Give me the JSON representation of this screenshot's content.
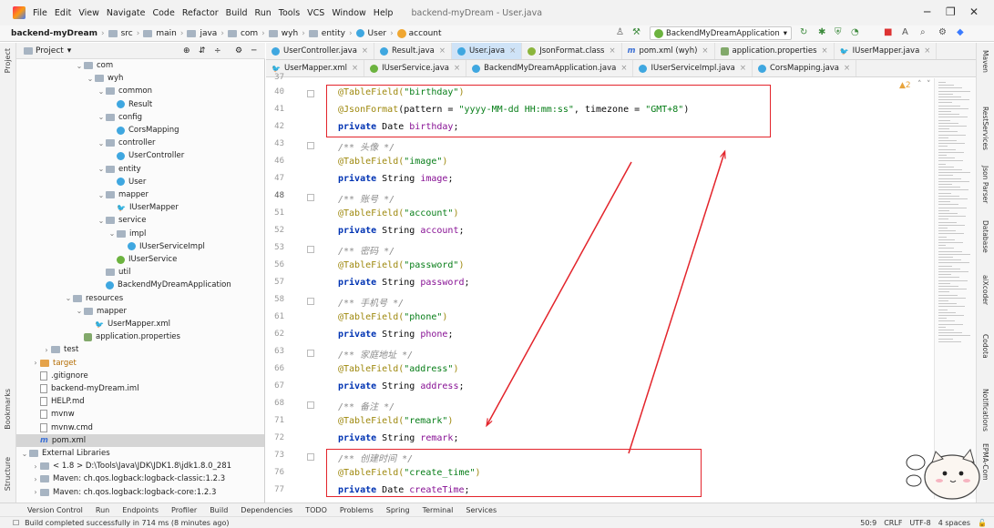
{
  "window": {
    "title": "backend-myDream - User.java",
    "menu": [
      "File",
      "Edit",
      "View",
      "Navigate",
      "Code",
      "Refactor",
      "Build",
      "Run",
      "Tools",
      "VCS",
      "Window",
      "Help"
    ]
  },
  "breadcrumb": [
    "backend-myDream",
    "src",
    "main",
    "java",
    "com",
    "wyh",
    "entity",
    "User",
    "account"
  ],
  "run_config": "BackendMyDreamApplication",
  "project": {
    "header": "Project",
    "tree": [
      {
        "label": "com",
        "type": "folder",
        "indent": 5,
        "arrow": "down"
      },
      {
        "label": "wyh",
        "type": "folder",
        "indent": 6,
        "arrow": "down"
      },
      {
        "label": "common",
        "type": "folder",
        "indent": 7,
        "arrow": "down"
      },
      {
        "label": "Result",
        "type": "class",
        "indent": 8,
        "arrow": ""
      },
      {
        "label": "config",
        "type": "folder",
        "indent": 7,
        "arrow": "down"
      },
      {
        "label": "CorsMapping",
        "type": "class",
        "indent": 8,
        "arrow": ""
      },
      {
        "label": "controller",
        "type": "folder",
        "indent": 7,
        "arrow": "down"
      },
      {
        "label": "UserController",
        "type": "class",
        "indent": 8,
        "arrow": ""
      },
      {
        "label": "entity",
        "type": "folder",
        "indent": 7,
        "arrow": "down"
      },
      {
        "label": "User",
        "type": "class",
        "indent": 8,
        "arrow": ""
      },
      {
        "label": "mapper",
        "type": "folder",
        "indent": 7,
        "arrow": "down"
      },
      {
        "label": "IUserMapper",
        "type": "mapper",
        "indent": 8,
        "arrow": ""
      },
      {
        "label": "service",
        "type": "folder",
        "indent": 7,
        "arrow": "down"
      },
      {
        "label": "impl",
        "type": "folder",
        "indent": 8,
        "arrow": "down"
      },
      {
        "label": "IUserServiceImpl",
        "type": "class",
        "indent": 9,
        "arrow": ""
      },
      {
        "label": "IUserService",
        "type": "interface",
        "indent": 8,
        "arrow": ""
      },
      {
        "label": "util",
        "type": "folder",
        "indent": 7,
        "arrow": ""
      },
      {
        "label": "BackendMyDreamApplication",
        "type": "class",
        "indent": 7,
        "arrow": ""
      },
      {
        "label": "resources",
        "type": "folder",
        "indent": 4,
        "arrow": "down"
      },
      {
        "label": "mapper",
        "type": "folder",
        "indent": 5,
        "arrow": "down"
      },
      {
        "label": "UserMapper.xml",
        "type": "mapper",
        "indent": 6,
        "arrow": ""
      },
      {
        "label": "application.properties",
        "type": "props",
        "indent": 5,
        "arrow": ""
      },
      {
        "label": "test",
        "type": "folder",
        "indent": 2,
        "arrow": "right"
      },
      {
        "label": "target",
        "type": "folder-orange",
        "indent": 1,
        "arrow": "right"
      },
      {
        "label": ".gitignore",
        "type": "file",
        "indent": 1,
        "arrow": ""
      },
      {
        "label": "backend-myDream.iml",
        "type": "file",
        "indent": 1,
        "arrow": ""
      },
      {
        "label": "HELP.md",
        "type": "file",
        "indent": 1,
        "arrow": ""
      },
      {
        "label": "mvnw",
        "type": "file",
        "indent": 1,
        "arrow": ""
      },
      {
        "label": "mvnw.cmd",
        "type": "file",
        "indent": 1,
        "arrow": ""
      },
      {
        "label": "pom.xml",
        "type": "pom",
        "indent": 1,
        "arrow": "",
        "selected": true
      },
      {
        "label": "External Libraries",
        "type": "lib",
        "indent": 0,
        "arrow": "down"
      },
      {
        "label": "< 1.8 >  D:\\Tools\\Java\\JDK\\JDK1.8\\jdk1.8.0_281",
        "type": "lib",
        "indent": 1,
        "arrow": "right"
      },
      {
        "label": "Maven: ch.qos.logback:logback-classic:1.2.3",
        "type": "lib",
        "indent": 1,
        "arrow": "right"
      },
      {
        "label": "Maven: ch.qos.logback:logback-core:1.2.3",
        "type": "lib",
        "indent": 1,
        "arrow": "right"
      }
    ]
  },
  "tabs_row1": [
    {
      "label": "UserController.java",
      "icon": "class"
    },
    {
      "label": "Result.java",
      "icon": "class"
    },
    {
      "label": "User.java",
      "icon": "class",
      "active": true
    },
    {
      "label": "JsonFormat.class",
      "icon": "annotation"
    },
    {
      "label": "pom.xml (wyh)",
      "icon": "pom"
    },
    {
      "label": "application.properties",
      "icon": "props"
    },
    {
      "label": "IUserMapper.java",
      "icon": "mapper"
    }
  ],
  "tabs_row2": [
    {
      "label": "UserMapper.xml",
      "icon": "mapper"
    },
    {
      "label": "IUserService.java",
      "icon": "interface"
    },
    {
      "label": "BackendMyDreamApplication.java",
      "icon": "class"
    },
    {
      "label": "IUserServiceImpl.java",
      "icon": "class"
    },
    {
      "label": "CorsMapping.java",
      "icon": "class"
    }
  ],
  "code_lines": [
    {
      "ln": "40",
      "tokens": [
        [
          "ann",
          "@TableField("
        ],
        [
          "str",
          "\"birthday\""
        ],
        [
          "ann",
          ")"
        ]
      ]
    },
    {
      "ln": "41",
      "tokens": [
        [
          "ann",
          "@JsonFormat"
        ],
        [
          "plain",
          "(pattern = "
        ],
        [
          "str",
          "\"yyyy-MM-dd HH:mm:ss\""
        ],
        [
          "plain",
          ", timezone = "
        ],
        [
          "str",
          "\"GMT+8\""
        ],
        [
          "plain",
          ")"
        ]
      ]
    },
    {
      "ln": "42",
      "tokens": [
        [
          "kw",
          "private "
        ],
        [
          "plain",
          "Date "
        ],
        [
          "fld",
          "birthday"
        ],
        [
          "plain",
          ";"
        ]
      ]
    },
    {
      "ln": "43",
      "tokens": [
        [
          "cmt",
          "/** 头像 */"
        ]
      ]
    },
    {
      "ln": "46",
      "tokens": [
        [
          "ann",
          "@TableField("
        ],
        [
          "str",
          "\"image\""
        ],
        [
          "ann",
          ")"
        ]
      ]
    },
    {
      "ln": "47",
      "tokens": [
        [
          "kw",
          "private "
        ],
        [
          "plain",
          "String "
        ],
        [
          "fld",
          "image"
        ],
        [
          "plain",
          ";"
        ]
      ]
    },
    {
      "ln": "48",
      "tokens": [
        [
          "cmt",
          "/** 账号 */"
        ]
      ]
    },
    {
      "ln": "51",
      "tokens": [
        [
          "ann",
          "@TableField("
        ],
        [
          "str",
          "\"account\""
        ],
        [
          "ann",
          ")"
        ]
      ]
    },
    {
      "ln": "52",
      "tokens": [
        [
          "kw",
          "private "
        ],
        [
          "plain",
          "String "
        ],
        [
          "fld",
          "account"
        ],
        [
          "plain",
          ";"
        ]
      ]
    },
    {
      "ln": "53",
      "tokens": [
        [
          "cmt",
          "/** 密码 */"
        ]
      ]
    },
    {
      "ln": "56",
      "tokens": [
        [
          "ann",
          "@TableField("
        ],
        [
          "str",
          "\"password\""
        ],
        [
          "ann",
          ")"
        ]
      ]
    },
    {
      "ln": "57",
      "tokens": [
        [
          "kw",
          "private "
        ],
        [
          "plain",
          "String "
        ],
        [
          "fld",
          "password"
        ],
        [
          "plain",
          ";"
        ]
      ]
    },
    {
      "ln": "58",
      "tokens": [
        [
          "cmt",
          "/** 手机号 */"
        ]
      ]
    },
    {
      "ln": "61",
      "tokens": [
        [
          "ann",
          "@TableField("
        ],
        [
          "str",
          "\"phone\""
        ],
        [
          "ann",
          ")"
        ]
      ]
    },
    {
      "ln": "62",
      "tokens": [
        [
          "kw",
          "private "
        ],
        [
          "plain",
          "String "
        ],
        [
          "fld",
          "phone"
        ],
        [
          "plain",
          ";"
        ]
      ]
    },
    {
      "ln": "63",
      "tokens": [
        [
          "cmt",
          "/** 家庭地址 */"
        ]
      ]
    },
    {
      "ln": "66",
      "tokens": [
        [
          "ann",
          "@TableField("
        ],
        [
          "str",
          "\"address\""
        ],
        [
          "ann",
          ")"
        ]
      ]
    },
    {
      "ln": "67",
      "tokens": [
        [
          "kw",
          "private "
        ],
        [
          "plain",
          "String "
        ],
        [
          "fld",
          "address"
        ],
        [
          "plain",
          ";"
        ]
      ]
    },
    {
      "ln": "68",
      "tokens": [
        [
          "cmt",
          "/** 备注 */"
        ]
      ]
    },
    {
      "ln": "71",
      "tokens": [
        [
          "ann",
          "@TableField("
        ],
        [
          "str",
          "\"remark\""
        ],
        [
          "ann",
          ")"
        ]
      ]
    },
    {
      "ln": "72",
      "tokens": [
        [
          "kw",
          "private "
        ],
        [
          "plain",
          "String "
        ],
        [
          "fld",
          "remark"
        ],
        [
          "plain",
          ";"
        ]
      ]
    },
    {
      "ln": "73",
      "tokens": [
        [
          "cmt",
          "/** 创建时间 */"
        ]
      ]
    },
    {
      "ln": "76",
      "tokens": [
        [
          "ann",
          "@TableField("
        ],
        [
          "str",
          "\"create_time\""
        ],
        [
          "ann",
          ")"
        ]
      ]
    },
    {
      "ln": "77",
      "tokens": [
        [
          "kw",
          "private "
        ],
        [
          "plain",
          "Date "
        ],
        [
          "fld",
          "createTime"
        ],
        [
          "plain",
          ";"
        ]
      ]
    }
  ],
  "inspection": "▲2",
  "right_tools": [
    "Maven",
    "RestServices",
    "Json Parser",
    "Database",
    "aiXcoder",
    "Codota",
    "Notifications",
    "EPMA-Com"
  ],
  "left_tools": [
    "Project",
    "Bookmarks",
    "Structure"
  ],
  "bottom_tabs": [
    "Version Control",
    "Run",
    "Endpoints",
    "Profiler",
    "Build",
    "Dependencies",
    "TODO",
    "Problems",
    "Spring",
    "Terminal",
    "Services"
  ],
  "status": {
    "message": "Build completed successfully in 714 ms (8 minutes ago)",
    "position": "50:9",
    "line_sep": "CRLF",
    "encoding": "UTF-8",
    "indent": "4 spaces"
  },
  "colors": {
    "highlight_red": "#e3242b",
    "keyword": "#0033b3",
    "annotation": "#9e880d",
    "string": "#067d17",
    "field": "#871094"
  }
}
